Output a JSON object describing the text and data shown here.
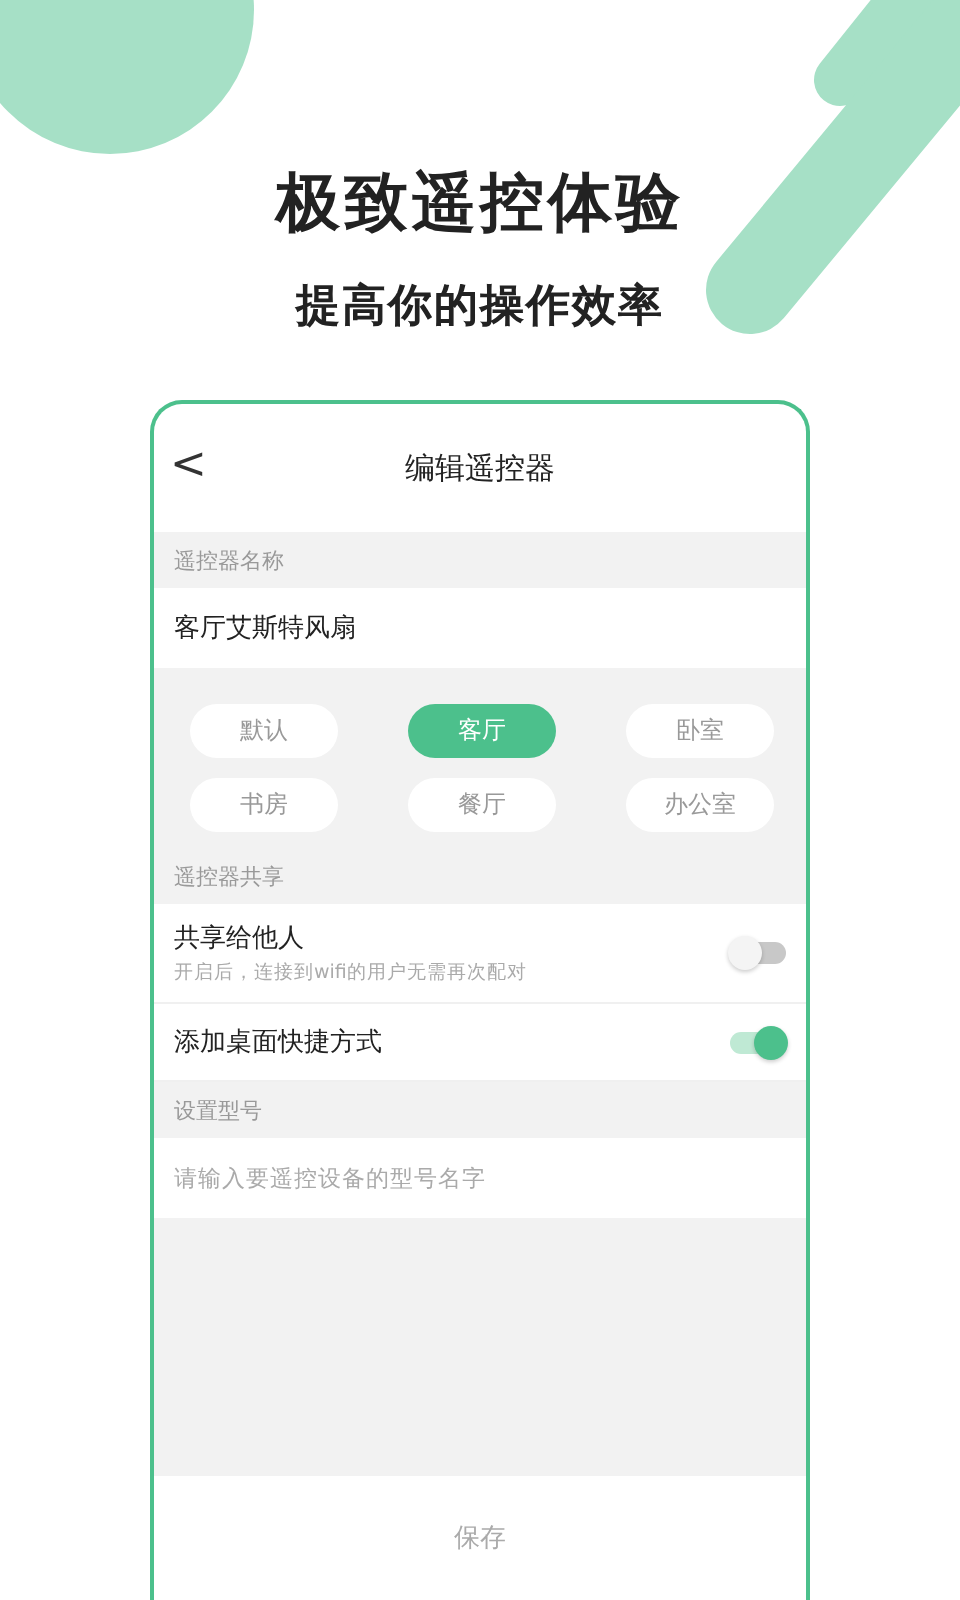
{
  "headline": "极致遥控体验",
  "subheadline": "提高你的操作效率",
  "screen": {
    "title": "编辑遥控器",
    "back": "<",
    "name_section": {
      "label": "遥控器名称",
      "value": "客厅艾斯特风扇"
    },
    "rooms": [
      {
        "label": "默认",
        "selected": false
      },
      {
        "label": "客厅",
        "selected": true
      },
      {
        "label": "卧室",
        "selected": false
      },
      {
        "label": "书房",
        "selected": false
      },
      {
        "label": "餐厅",
        "selected": false
      },
      {
        "label": "办公室",
        "selected": false
      }
    ],
    "share_section": {
      "label": "遥控器共享",
      "rows": [
        {
          "title": "共享给他人",
          "subtitle": "开启后，连接到wifi的用户无需再次配对",
          "on": false
        },
        {
          "title": "添加桌面快捷方式",
          "on": true
        }
      ]
    },
    "model_section": {
      "label": "设置型号",
      "placeholder": "请输入要遥控设备的型号名字"
    },
    "save": "保存"
  }
}
